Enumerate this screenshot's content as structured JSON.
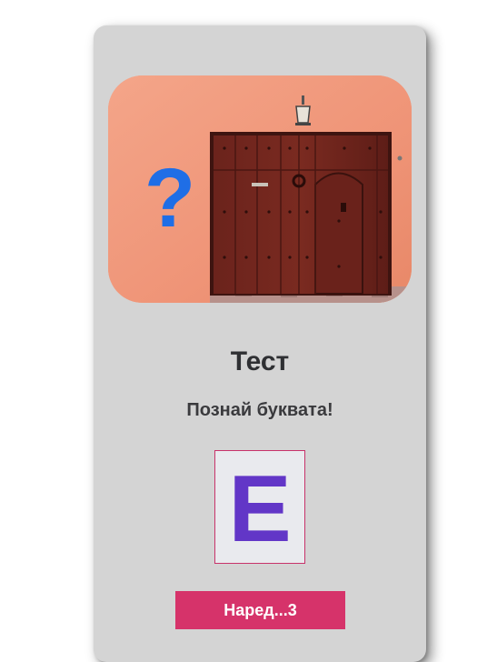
{
  "card": {
    "title": "Тест",
    "subtitle": "Познай буквата!",
    "letter": "E",
    "next_button_label": "Наред...3"
  },
  "hero": {
    "image": "orange-wall-with-wooden-door",
    "icon": "question-mark-icon"
  },
  "colors": {
    "card_background": "#d4d4d4",
    "accent": "#d6336a",
    "letter_color": "#6236c7",
    "question_mark": "#1f6ee6"
  }
}
